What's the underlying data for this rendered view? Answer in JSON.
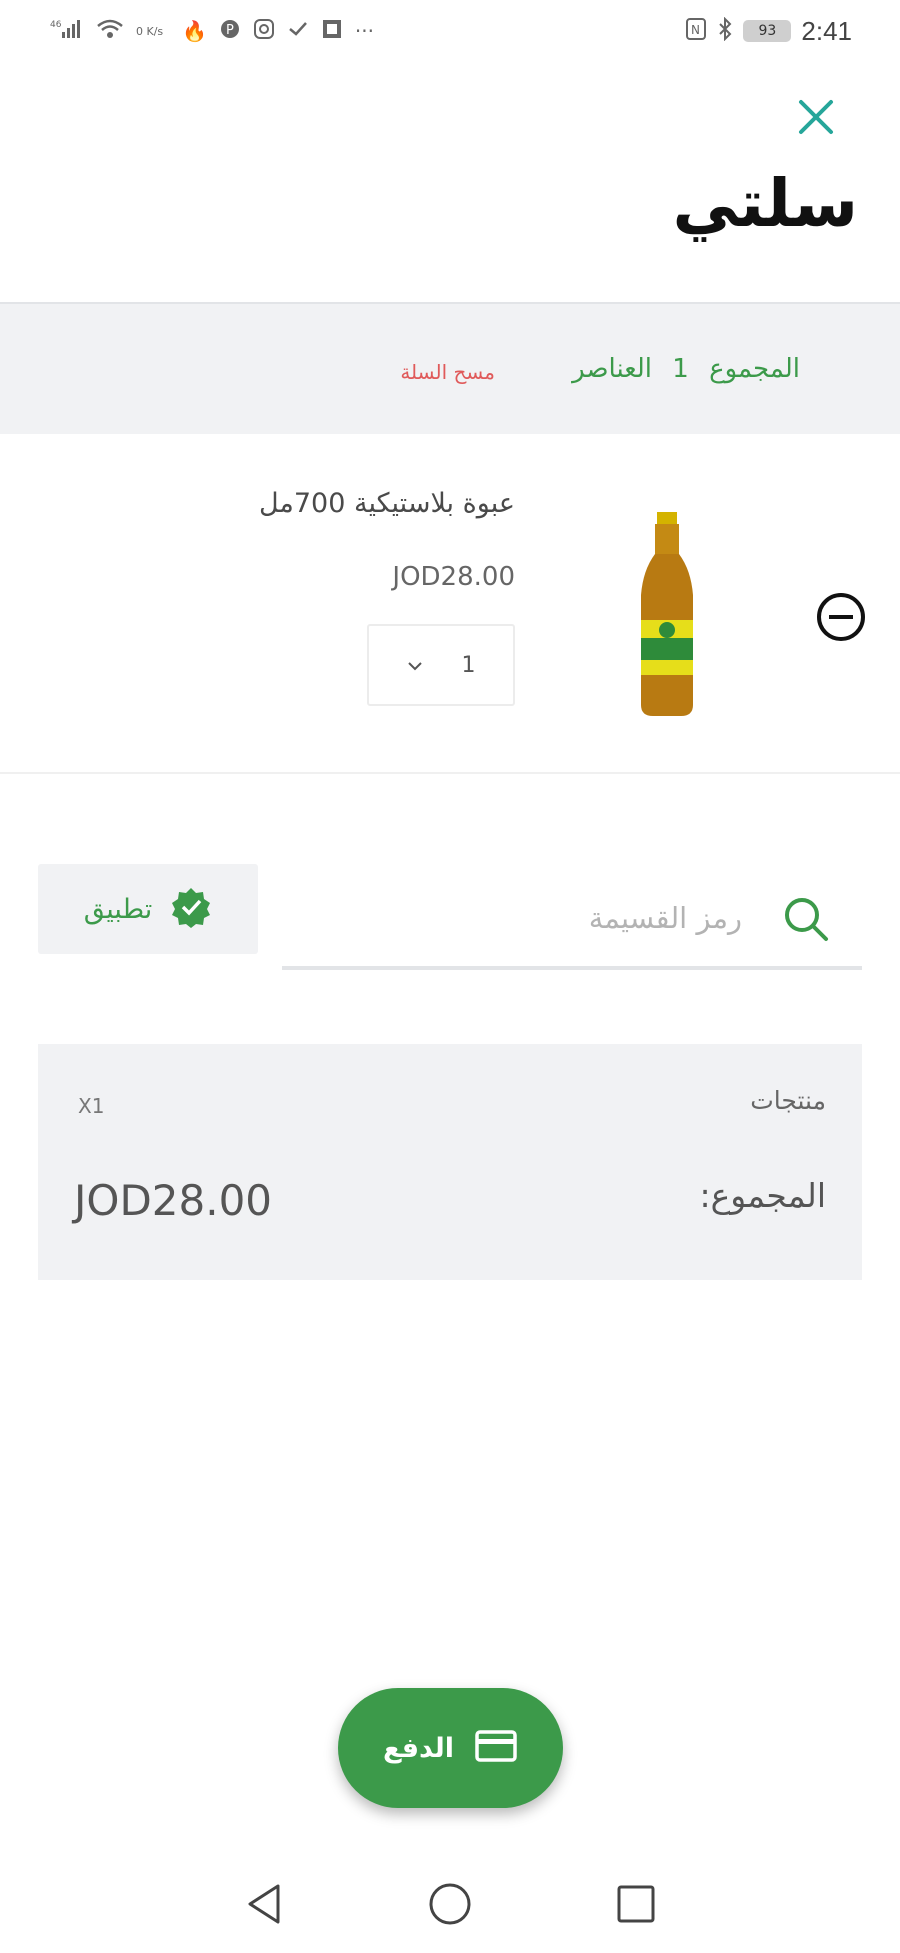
{
  "status_bar": {
    "left_text": "⁴⁶",
    "speed": "0 K/s",
    "battery": "93",
    "time": "2:41",
    "more": "···"
  },
  "header": {
    "title": "سلتي",
    "close_icon": "close-icon"
  },
  "summary": {
    "label": "المجموع",
    "count": "1",
    "items_label": "العناصر",
    "clear_label": "مسح السلة"
  },
  "cart_item": {
    "name": "عبوة بلاستيكية 700مل",
    "price": "JOD28.00",
    "quantity": "1",
    "remove_icon": "minus-circle-icon"
  },
  "coupon": {
    "placeholder": "رمز القسيمة",
    "apply_label": "تطبيق"
  },
  "order_summary": {
    "products_label": "منتجات",
    "products_qty": "X1",
    "total_label": "المجموع:",
    "total_value": "JOD28.00"
  },
  "checkout": {
    "label": "الدفع",
    "icon": "credit-card-icon"
  },
  "colors": {
    "accent": "#3c9a4a",
    "close": "#26a69a",
    "danger": "#e05a5a",
    "band": "#f1f2f4"
  }
}
